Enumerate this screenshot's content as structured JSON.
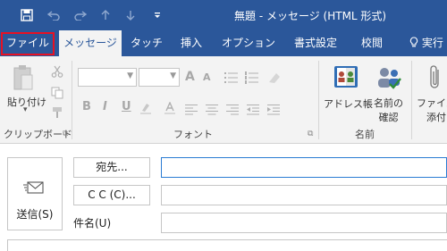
{
  "window": {
    "title": "無題 - メッセージ (HTML 形式)",
    "accent_color": "#2b579a"
  },
  "quick_access": {
    "save_icon": "save-icon",
    "undo_icon": "undo-icon",
    "redo_icon": "redo-icon",
    "up_icon": "arrow-up-icon",
    "down_icon": "arrow-down-icon",
    "customize_icon": "customize-icon"
  },
  "tabs": [
    {
      "label": "ファイル"
    },
    {
      "label": "メッセージ"
    },
    {
      "label": "タッチ"
    },
    {
      "label": "挿入"
    },
    {
      "label": "オプション"
    },
    {
      "label": "書式設定"
    },
    {
      "label": "校閲"
    },
    {
      "label": "実行"
    }
  ],
  "ribbon": {
    "clipboard": {
      "paste_label": "貼り付け",
      "paste_arrow": "▾",
      "group_label": "クリップボード"
    },
    "font": {
      "group_label": "フォント",
      "font_name": "",
      "font_size": "",
      "format_buttons": [
        "B",
        "I",
        "U"
      ],
      "grow_glyph": "A",
      "shrink_glyph": "A"
    },
    "names": {
      "address_book_label": "アドレス帳",
      "check_names_line1": "名前の",
      "check_names_line2": "確認",
      "group_label": "名前"
    },
    "include": {
      "attach_line1": "ファイル",
      "attach_line2": "添付"
    }
  },
  "compose": {
    "send_label": "送信(S)",
    "to_button": "宛先...",
    "cc_button": "C C (C)...",
    "subject_label": "件名(U)",
    "to_value": "",
    "cc_value": "",
    "subject_value": ""
  }
}
